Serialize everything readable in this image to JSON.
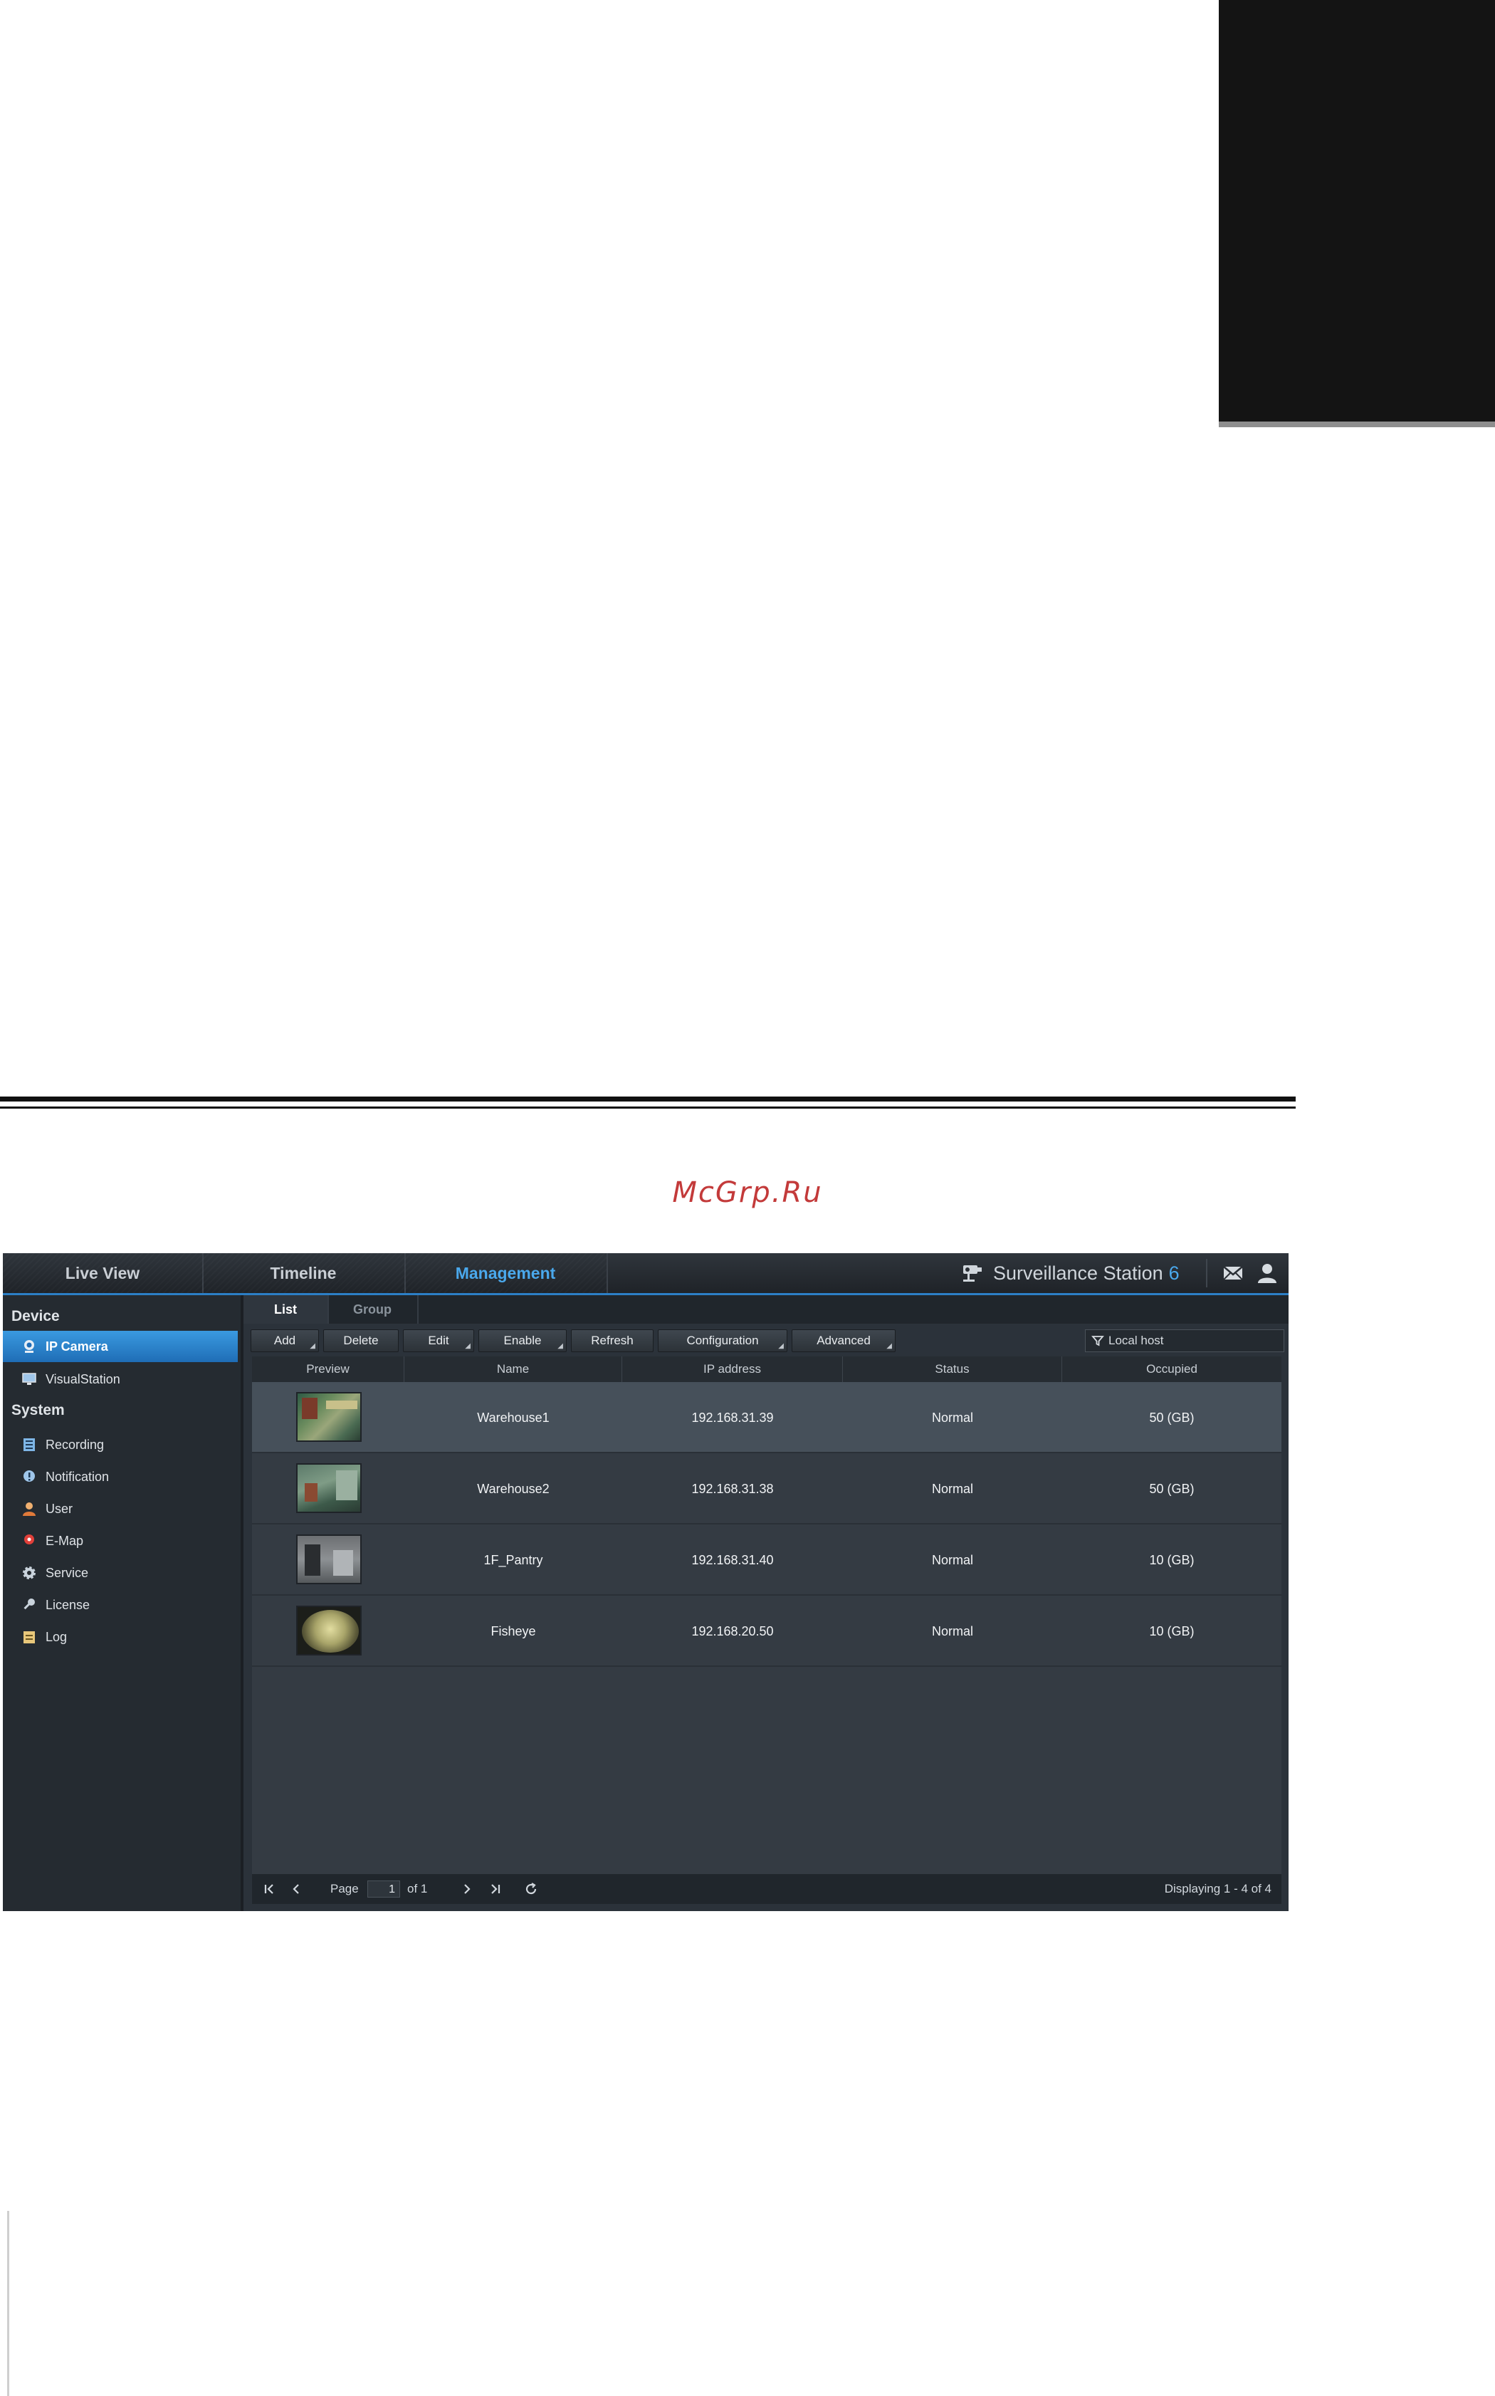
{
  "watermark": "McGrp.Ru",
  "app": {
    "tabs": [
      {
        "label": "Live View"
      },
      {
        "label": "Timeline"
      },
      {
        "label": "Management"
      }
    ],
    "brand": {
      "name": "Surveillance Station",
      "version": "6"
    },
    "accent_color": "#4aa8ec"
  },
  "sidebar": {
    "sections": [
      {
        "label": "Device",
        "items": [
          {
            "label": "IP Camera",
            "icon": "camera-icon"
          },
          {
            "label": "VisualStation",
            "icon": "monitor-icon"
          }
        ]
      },
      {
        "label": "System",
        "items": [
          {
            "label": "Recording",
            "icon": "recording-icon"
          },
          {
            "label": "Notification",
            "icon": "notification-icon"
          },
          {
            "label": "User",
            "icon": "user-icon"
          },
          {
            "label": "E-Map",
            "icon": "map-pin-icon"
          },
          {
            "label": "Service",
            "icon": "gear-icon"
          },
          {
            "label": "License",
            "icon": "key-icon"
          },
          {
            "label": "Log",
            "icon": "log-icon"
          }
        ]
      }
    ]
  },
  "subtabs": [
    {
      "label": "List"
    },
    {
      "label": "Group"
    }
  ],
  "toolbar": {
    "buttons": [
      {
        "label": "Add"
      },
      {
        "label": "Delete"
      },
      {
        "label": "Edit"
      },
      {
        "label": "Enable"
      },
      {
        "label": "Refresh"
      },
      {
        "label": "Configuration"
      },
      {
        "label": "Advanced"
      }
    ],
    "filter_value": "Local host"
  },
  "table": {
    "columns": [
      "Preview",
      "Name",
      "IP address",
      "Status",
      "Occupied"
    ],
    "rows": [
      {
        "name": "Warehouse1",
        "ip": "192.168.31.39",
        "status": "Normal",
        "occupied": "50 (GB)"
      },
      {
        "name": "Warehouse2",
        "ip": "192.168.31.38",
        "status": "Normal",
        "occupied": "50 (GB)"
      },
      {
        "name": "1F_Pantry",
        "ip": "192.168.31.40",
        "status": "Normal",
        "occupied": "10 (GB)"
      },
      {
        "name": "Fisheye",
        "ip": "192.168.20.50",
        "status": "Normal",
        "occupied": "10 (GB)"
      }
    ]
  },
  "pager": {
    "page_label": "Page",
    "page_value": "1",
    "of_label": "of 1",
    "displaying": "Displaying 1 - 4 of 4"
  }
}
